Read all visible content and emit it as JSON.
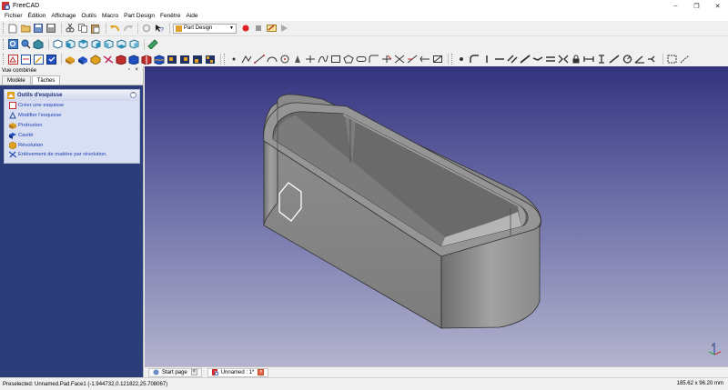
{
  "window": {
    "title": "FreeCAD",
    "controls": {
      "minimize": "–",
      "maximize": "❐",
      "close": "✕"
    }
  },
  "menu": [
    "Fichier",
    "Édition",
    "Affichage",
    "Outils",
    "Macro",
    "Part Design",
    "Fenêtre",
    "Aide"
  ],
  "toolbar": {
    "workbench": "Part Design",
    "row1_icons": [
      "new-document-icon",
      "open-icon",
      "save-icon",
      "save-as-icon",
      "cut-icon",
      "copy-icon",
      "paste-icon",
      "undo-icon",
      "redo-icon",
      "refresh-icon",
      "whats-this-icon"
    ],
    "macro_icons": [
      "record-macro-icon",
      "stop-macro-icon",
      "macro-editor-icon",
      "run-macro-icon"
    ],
    "row2_icons": [
      "fit-all-icon",
      "fit-selection-icon",
      "draw-style-icon",
      "view-isometric-icon",
      "view-front-icon",
      "view-top-icon",
      "view-right-icon",
      "view-rear-icon",
      "view-bottom-icon",
      "view-left-icon",
      "measure-icon"
    ],
    "row3_part_icons": [
      "new-sketch-icon",
      "map-sketch-icon",
      "edit-sketch-icon",
      "validate-sketch-icon",
      "pad-icon",
      "pocket-icon",
      "revolution-icon",
      "groove-icon",
      "fillet-icon",
      "chamfer-icon",
      "draft-icon",
      "mirrored-icon",
      "linear-pattern-icon",
      "polar-pattern-icon",
      "scaled-icon",
      "multi-transform-icon"
    ],
    "row3_sketch_icons": [
      "point-icon",
      "polyline-icon",
      "line-icon",
      "arc-icon",
      "circle-icon",
      "ellipse-icon",
      "conic-icon",
      "bspline-icon",
      "rectangle-icon",
      "polygon-icon",
      "slot-icon",
      "fillet-sketch-icon",
      "trim-icon",
      "extend-icon",
      "external-geometry-icon",
      "carbon-copy-icon",
      "construction-mode-icon"
    ],
    "row3_constraint_icons": [
      "constrain-coincident-icon",
      "constrain-point-on-object-icon",
      "constrain-vertical-icon",
      "constrain-horizontal-icon",
      "constrain-parallel-icon",
      "constrain-perpendicular-icon",
      "constrain-tangent-icon",
      "constrain-equal-icon",
      "constrain-symmetric-icon",
      "constrain-lock-icon",
      "constrain-horizontal-distance-icon",
      "constrain-vertical-distance-icon",
      "constrain-distance-icon",
      "constrain-radius-icon",
      "constrain-angle-icon",
      "constrain-snell-icon",
      "constrain-internal-alignment-icon",
      "toggle-driving-icon"
    ]
  },
  "combo": {
    "title": "Vue combinée",
    "controls": "▫ ×",
    "tabs": [
      "Modèle",
      "Tâches"
    ],
    "taskbox": {
      "title": "Outils d'esquisse",
      "collapse": "⌃",
      "items": [
        "Créer une esquisse",
        "Modifier l'esquisse",
        "Protrusion",
        "Cavité",
        "Révolution",
        "Enlèvement de matière par révolution."
      ]
    }
  },
  "doctabs": [
    {
      "label": "Start page",
      "close": "×"
    },
    {
      "label": "Unnamed : 1*",
      "close": "×"
    }
  ],
  "status": {
    "message": "Preselected: Unnamed.Pad.Face1 (-1.944732,0.121822,25.708067)",
    "dimensions": "185.62 x 96.20 mm"
  },
  "colors": {
    "viewport_top": "#33337f",
    "viewport_bottom": "#b3b3ce",
    "model_gray": "#8c8c8c",
    "task_link": "#1d3db8"
  }
}
